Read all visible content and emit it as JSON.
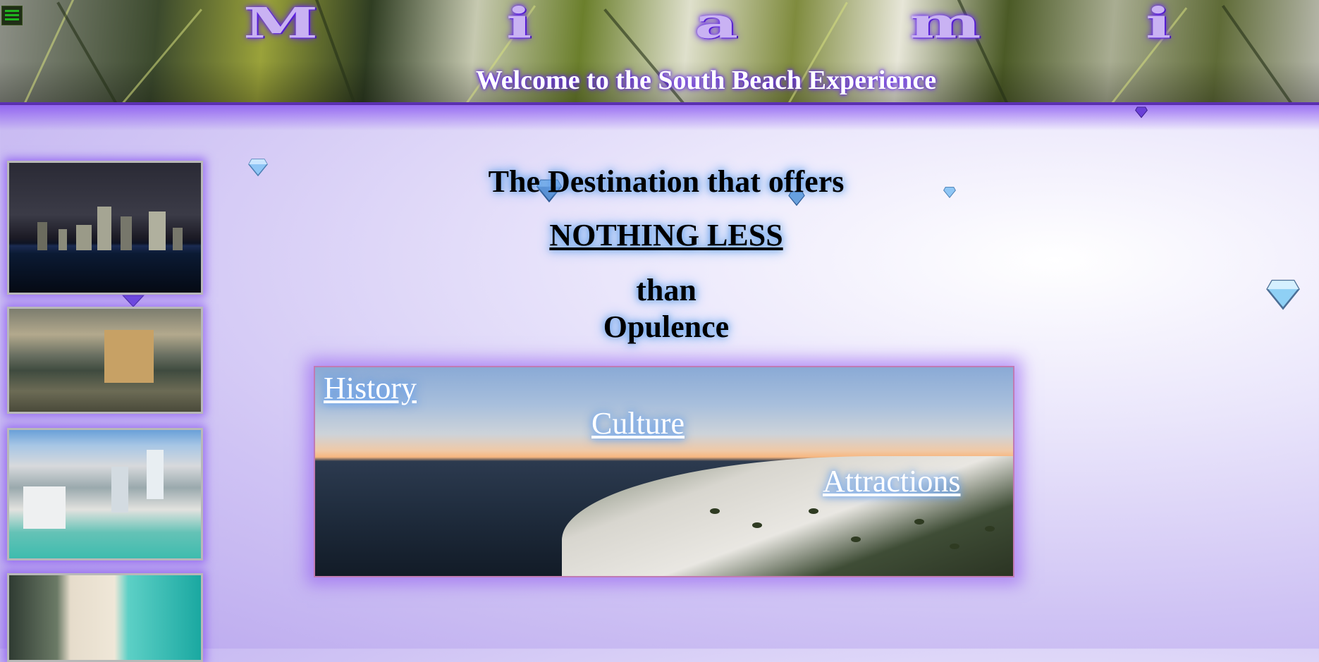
{
  "header": {
    "title_letters": [
      "M",
      "i",
      "a",
      "m",
      "i"
    ],
    "subtitle": "Welcome to the South Beach Experience"
  },
  "menu": {
    "icon": "hamburger-menu-icon"
  },
  "tagline": {
    "line1": "The Destination that offers",
    "line2": "NOTHING LESS",
    "line3": "than",
    "line4": "Opulence"
  },
  "hero": {
    "links": {
      "history": "History",
      "culture": "Culture",
      "attractions": "Attractions"
    }
  },
  "sidebar": {
    "thumbnails": [
      "miami-night-skyline",
      "beach-resort-hotel",
      "aerial-beachfront-towers",
      "aerial-beach-shore"
    ]
  },
  "decorations": {
    "icon": "diamond-icon"
  },
  "colors": {
    "accent_purple": "#6a2bff",
    "title_fill": "#c9b2f3",
    "link_glow": "#7fb6ff"
  }
}
